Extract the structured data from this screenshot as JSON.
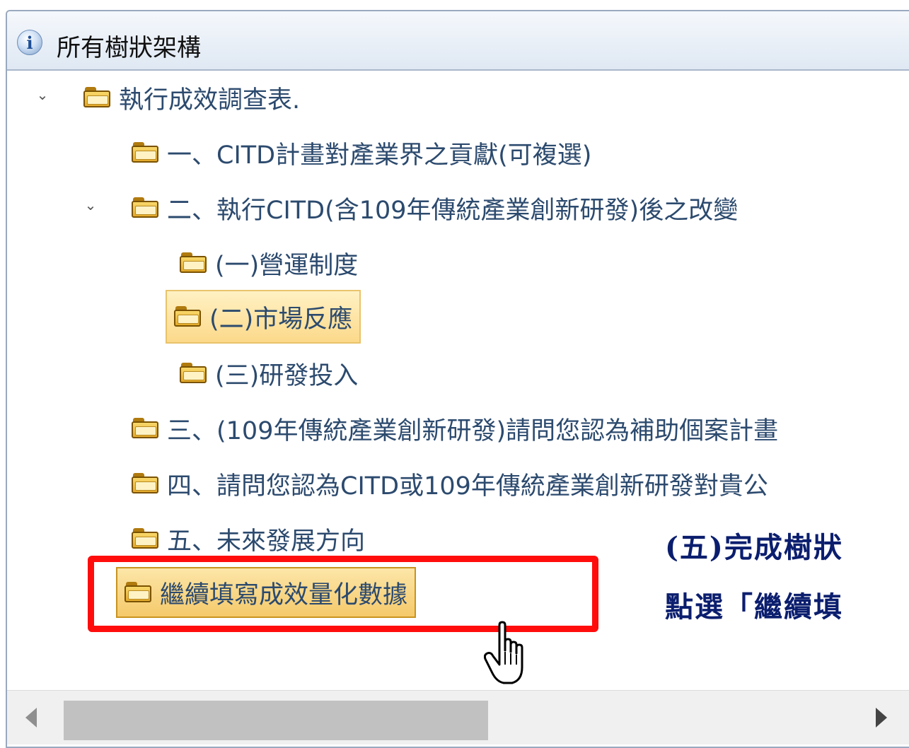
{
  "panel": {
    "title": "所有樹狀架構"
  },
  "tree": {
    "root": "執行成效調查表.",
    "item_1": "一、CITD計畫對產業界之貢獻(可複選)",
    "item_2": "二、執行CITD(含109年傳統產業創新研發)後之改變",
    "item_2_1": "(一)營運制度",
    "item_2_2": "(二)市場反應",
    "item_2_3": "(三)研發投入",
    "item_3": "三、(109年傳統產業創新研發)請問您認為補助個案計畫",
    "item_4": "四、請問您認為CITD或109年傳統產業創新研發對貴公",
    "item_5": "五、未來發展方向",
    "item_continue": "繼續填寫成效量化數據"
  },
  "annotation": {
    "line1": "(五)完成樹狀",
    "line2": "點選「繼續填"
  },
  "colors": {
    "highlight_border": "#ff0d0d",
    "annotation_text": "#0b1e6e",
    "tree_text": "#2c4a6e"
  },
  "icons": [
    "info-icon",
    "chevron-down-icon",
    "folder-icon",
    "hand-pointer-icon",
    "scroll-left-icon",
    "scroll-right-icon"
  ]
}
